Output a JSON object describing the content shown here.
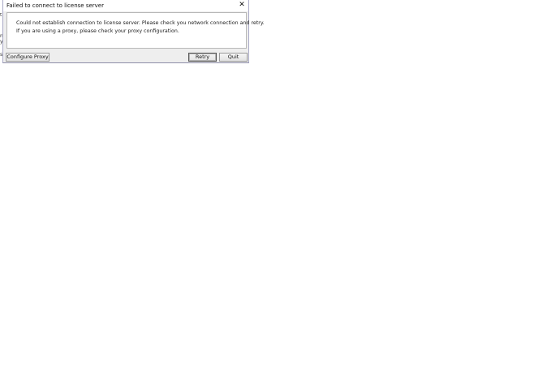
{
  "background_fragments": [
    "t",
    "n",
    "y",
    "s"
  ],
  "dialog": {
    "title": "Failed to connect to license server",
    "close_glyph": "✕",
    "message_lines": [
      "Could not establish connection to license server. Please check you network connection and retry.",
      "If you are using a proxy, please check your proxy configuration."
    ],
    "buttons": {
      "configure_proxy": "Configure Proxy",
      "retry": "Retry",
      "quit": "Quit"
    }
  },
  "colors": {
    "dialog_border": "#a9a9c6",
    "dialog_bg": "#eeeeee",
    "panel_bg": "#ffffff"
  },
  "icons": [
    "close-icon"
  ]
}
